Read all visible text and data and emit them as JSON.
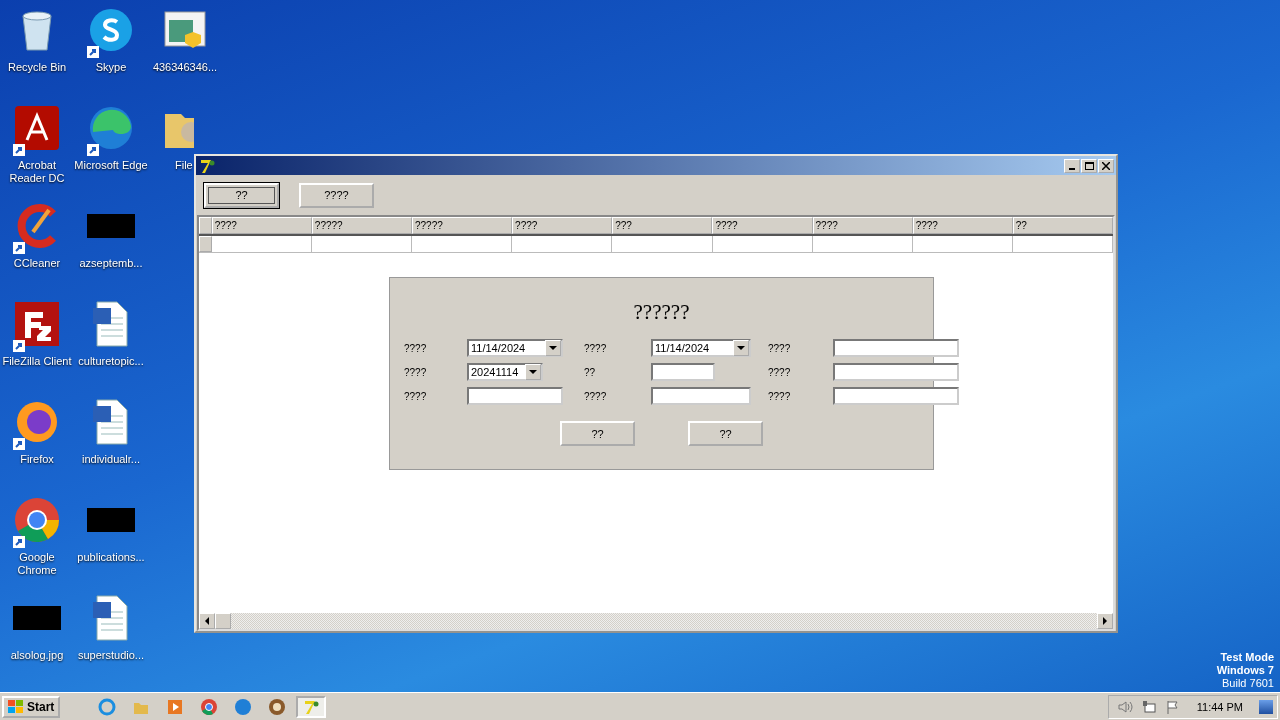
{
  "desktop": {
    "icons": [
      {
        "label": "Recycle Bin",
        "kind": "recycle",
        "shortcut": false
      },
      {
        "label": "Acrobat Reader DC",
        "kind": "acrobat",
        "shortcut": true
      },
      {
        "label": "CCleaner",
        "kind": "ccleaner",
        "shortcut": true
      },
      {
        "label": "FileZilla Client",
        "kind": "filezilla",
        "shortcut": true
      },
      {
        "label": "Firefox",
        "kind": "firefox",
        "shortcut": true
      },
      {
        "label": "Google Chrome",
        "kind": "chrome",
        "shortcut": true
      },
      {
        "label": "alsolog.jpg",
        "kind": "blackimage",
        "shortcut": false
      },
      {
        "label": "Skype",
        "kind": "skype",
        "shortcut": true
      },
      {
        "label": "Microsoft Edge",
        "kind": "edge",
        "shortcut": true
      },
      {
        "label": "azseptemb...",
        "kind": "blackimage",
        "shortcut": false
      },
      {
        "label": "culturetopic...",
        "kind": "word",
        "shortcut": false
      },
      {
        "label": "individualr...",
        "kind": "word",
        "shortcut": false
      },
      {
        "label": "publications...",
        "kind": "blackimage",
        "shortcut": false
      },
      {
        "label": "superstudio...",
        "kind": "word",
        "shortcut": false
      },
      {
        "label": "436346346...",
        "kind": "installer",
        "shortcut": false
      },
      {
        "label": "File",
        "kind": "folder",
        "shortcut": false
      }
    ]
  },
  "window": {
    "toolbar": [
      {
        "label": "??",
        "focused": true
      },
      {
        "label": "????",
        "focused": false
      }
    ],
    "table": {
      "columns": [
        "????",
        "?????",
        "?????",
        "????",
        "???",
        "????",
        "????",
        "????",
        "??"
      ]
    },
    "dialog": {
      "title": "??????",
      "fields": [
        {
          "label": "????",
          "kind": "date",
          "value": "11/14/2024"
        },
        {
          "label": "????",
          "kind": "date",
          "value": "11/14/2024"
        },
        {
          "label": "????",
          "kind": "text"
        },
        {
          "label": "????",
          "kind": "combo",
          "value": "20241114"
        },
        {
          "label": "??",
          "kind": "short"
        },
        {
          "label": "????",
          "kind": "text"
        },
        {
          "label": "????",
          "kind": "text"
        },
        {
          "label": "????",
          "kind": "text"
        },
        {
          "label": "????",
          "kind": "text"
        }
      ],
      "buttons": [
        "??",
        "??"
      ]
    }
  },
  "watermark": {
    "lines": [
      "Test Mode",
      "Windows 7",
      "Build 7601"
    ]
  },
  "taskbar": {
    "start": "Start",
    "items": [
      {
        "kind": "ie",
        "selected": false
      },
      {
        "kind": "explorer",
        "selected": false
      },
      {
        "kind": "media",
        "selected": false
      },
      {
        "kind": "chrome",
        "selected": false
      },
      {
        "kind": "edge",
        "selected": false
      },
      {
        "kind": "round",
        "selected": false
      },
      {
        "kind": "app7",
        "selected": true
      }
    ],
    "tray": [
      {
        "kind": "speaker"
      },
      {
        "kind": "network"
      },
      {
        "kind": "flag"
      }
    ],
    "time": "11:44 PM"
  }
}
